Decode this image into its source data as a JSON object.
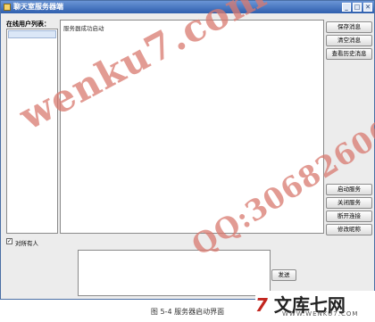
{
  "window": {
    "title": "聊天室服务器端"
  },
  "title_buttons": [
    {
      "icon": "minimize-icon",
      "glyph": "_"
    },
    {
      "icon": "maximize-icon",
      "glyph": "□"
    },
    {
      "icon": "close-icon",
      "glyph": "✕"
    }
  ],
  "user_panel": {
    "label": "在线用户列表："
  },
  "log": {
    "lines": [
      "服务器成功启动"
    ]
  },
  "top_buttons": [
    "保存消息",
    "清空消息",
    "查看历史消息"
  ],
  "bottom_buttons": [
    "启动服务",
    "关闭服务",
    "断开连接",
    "修改昵称"
  ],
  "checkbox": {
    "label": "对所有人",
    "checked": true
  },
  "message": {
    "value": "",
    "send_label": "发送"
  },
  "caption": "图 5-4 服务器启动界面",
  "watermark": {
    "text": "wenku7.com",
    "qq": "QQ:306826066"
  },
  "logo": {
    "brand_prefix": "7",
    "brand_text": "文库七网",
    "domain": "WWW.WENKU7.COM"
  },
  "colors": {
    "titlebar": "#2f5fae",
    "watermark": "#d97a70",
    "logo_accent": "#c2261f"
  }
}
